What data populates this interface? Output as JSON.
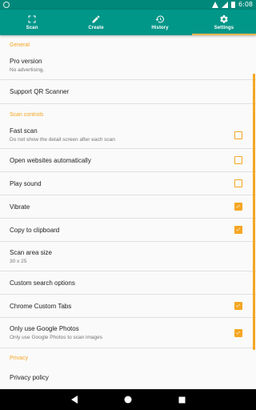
{
  "status_bar": {
    "time": "6:08"
  },
  "tabs": [
    {
      "label": "Scan",
      "icon": "scan-icon"
    },
    {
      "label": "Create",
      "icon": "pencil-icon"
    },
    {
      "label": "History",
      "icon": "history-icon"
    },
    {
      "label": "Settings",
      "icon": "gear-icon",
      "active": true
    }
  ],
  "colors": {
    "primary": "#009688",
    "status_bar": "#00897b",
    "accent": "#f5a623"
  },
  "sections": {
    "general": "General",
    "scan_controls": "Scan controls",
    "privacy": "Privacy"
  },
  "prefs": {
    "pro_version": {
      "title": "Pro version",
      "summary": "No advertising."
    },
    "support": {
      "title": "Support QR Scanner"
    },
    "fast_scan": {
      "title": "Fast scan",
      "summary": "Do not show the detail screen after each scan",
      "checked": false
    },
    "open_websites": {
      "title": "Open websites automatically",
      "checked": false
    },
    "play_sound": {
      "title": "Play sound",
      "checked": false
    },
    "vibrate": {
      "title": "Vibrate",
      "checked": true
    },
    "copy_clipboard": {
      "title": "Copy to clipboard",
      "checked": true
    },
    "scan_area": {
      "title": "Scan area size",
      "summary": "30 x 25"
    },
    "custom_search": {
      "title": "Custom search options"
    },
    "chrome_tabs": {
      "title": "Chrome Custom Tabs",
      "checked": true
    },
    "google_photos": {
      "title": "Only use Google Photos",
      "summary": "Only use Google Photos to scan images",
      "checked": true
    },
    "privacy_policy": {
      "title": "Privacy policy"
    }
  },
  "nav": {
    "back": "back-icon",
    "home": "home-icon",
    "recents": "recents-icon"
  }
}
